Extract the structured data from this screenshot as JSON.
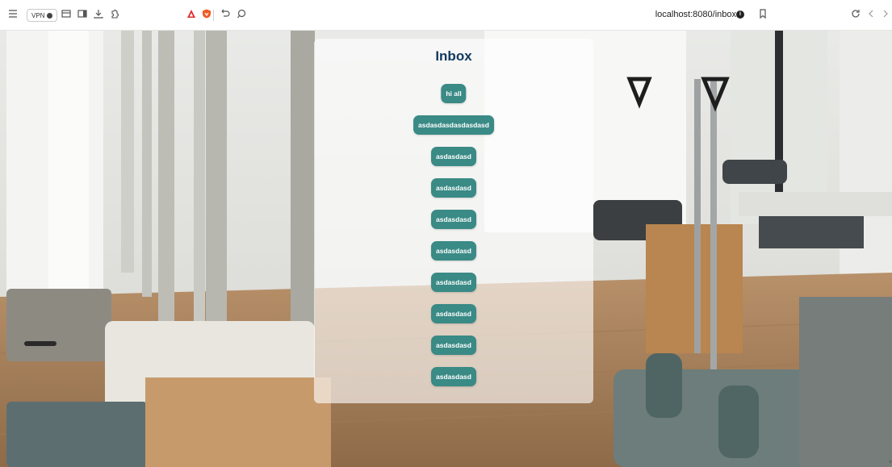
{
  "browser": {
    "vpn_label": "VPN",
    "url": "localhost:8080/inbox",
    "info_label": "i"
  },
  "inbox": {
    "title": "Inbox",
    "messages": [
      "hi all",
      "asdasdasdasdasdasd",
      "asdasdasd",
      "asdasdasd",
      "asdasdasd",
      "asdasdasd",
      "asdasdasd",
      "asdasdasd",
      "asdasdasd",
      "asdasdasd"
    ]
  },
  "colors": {
    "message_bubble": "#3a8a86",
    "title_text": "#123a5e",
    "panel_background": "rgba(255,255,255,0.62)"
  }
}
